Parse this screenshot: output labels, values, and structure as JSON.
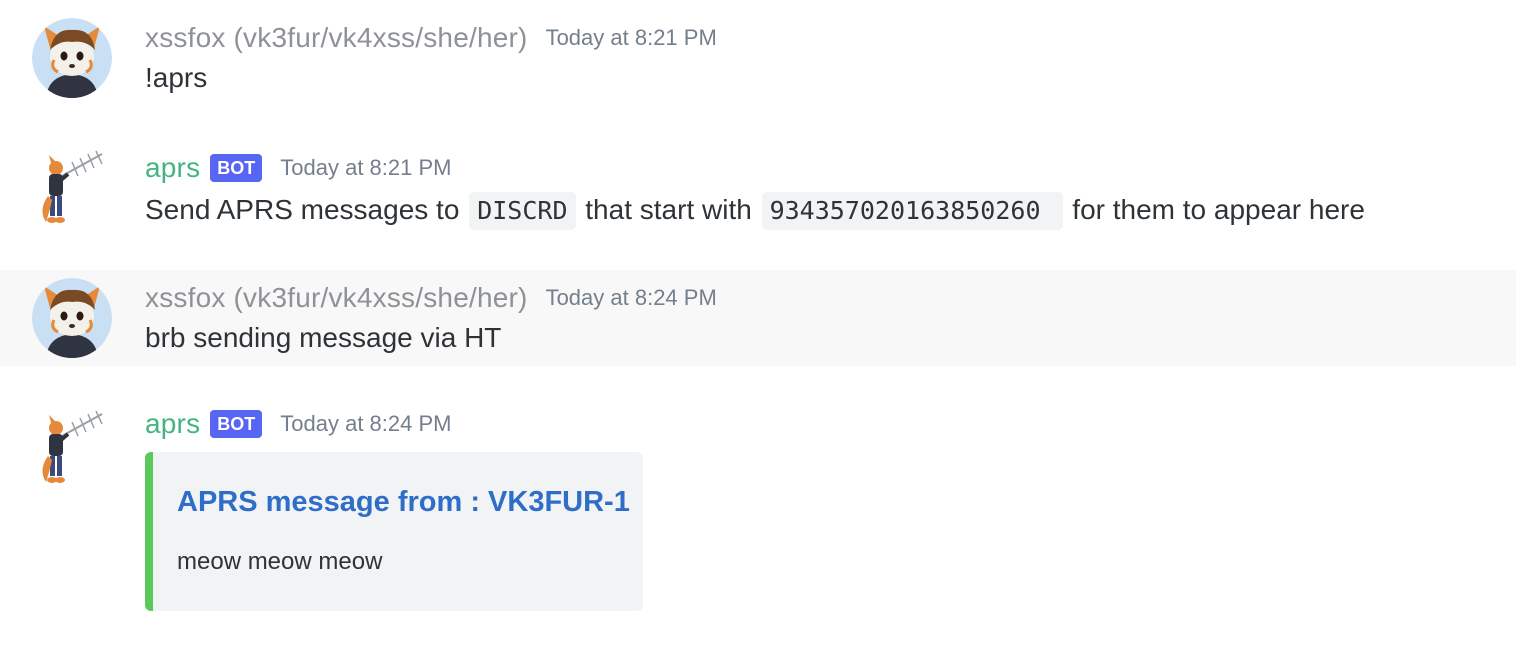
{
  "colors": {
    "user_name": "#8e9297",
    "bot_name": "#43b581",
    "bot_tag_bg": "#5865f2",
    "embed_accent": "#5ac85a",
    "embed_title": "#2e6ec9",
    "hover_bg": "#f8f8f8"
  },
  "messages": [
    {
      "author": "xssfox (vk3fur/vk4xss/she/her)",
      "is_bot": false,
      "timestamp": "Today at 8:21 PM",
      "avatar_icon": "fox-avatar-icon",
      "text": "!aprs"
    },
    {
      "author": "aprs",
      "is_bot": true,
      "bot_tag": "BOT",
      "timestamp": "Today at 8:21 PM",
      "avatar_icon": "fox-antenna-avatar-icon",
      "text_parts": {
        "p1": "Send APRS messages to",
        "code1": "DISCRD",
        "p2": "that start with",
        "code2": "934357020163850260",
        "p3": "for them to appear here"
      }
    },
    {
      "author": "xssfox (vk3fur/vk4xss/she/her)",
      "is_bot": false,
      "timestamp": "Today at 8:24 PM",
      "avatar_icon": "fox-avatar-icon",
      "text": "brb sending message via HT"
    },
    {
      "author": "aprs",
      "is_bot": true,
      "bot_tag": "BOT",
      "timestamp": "Today at 8:24 PM",
      "avatar_icon": "fox-antenna-avatar-icon",
      "embed": {
        "title": "APRS message from : VK3FUR-1",
        "description": "meow meow meow"
      }
    }
  ]
}
